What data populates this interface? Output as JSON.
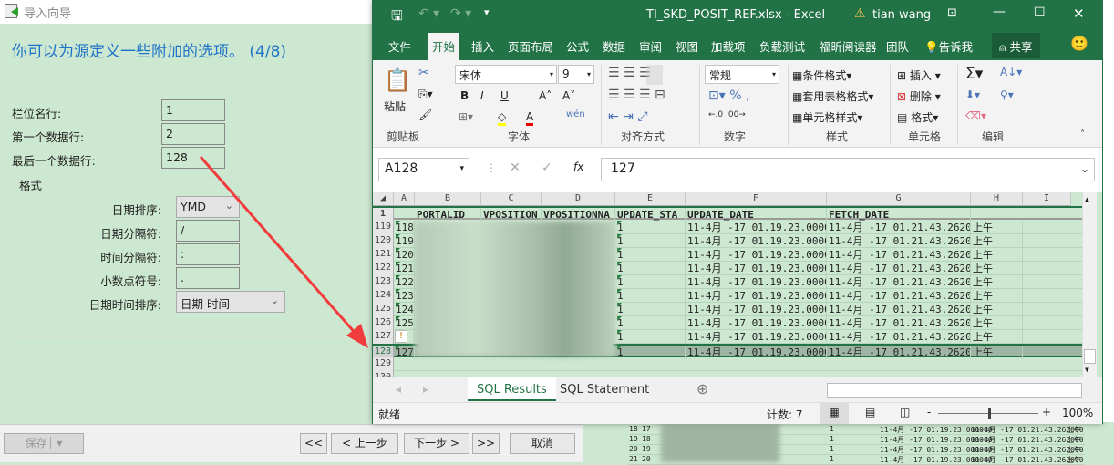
{
  "dialog": {
    "title": "导入向导",
    "heading": "你可以为源定义一些附加的选项。 (4/8)",
    "fields": [
      {
        "label": "栏位名行:",
        "value": "1"
      },
      {
        "label": "第一个数据行:",
        "value": "2"
      },
      {
        "label": "最后一个数据行:",
        "value": "128"
      }
    ],
    "format_label": "格式",
    "format_fields": [
      {
        "label": "日期排序:",
        "value": "YMD",
        "type": "select"
      },
      {
        "label": "日期分隔符:",
        "value": "/",
        "type": "input"
      },
      {
        "label": "时间分隔符:",
        "value": ":",
        "type": "input"
      },
      {
        "label": "小数点符号:",
        "value": ".",
        "type": "input"
      },
      {
        "label": "日期时间排序:",
        "value": "日期 时间",
        "type": "select"
      }
    ],
    "buttons": {
      "save": "保存",
      "first": "<<",
      "prev": "< 上一步",
      "next": "下一步 >",
      "last": ">>",
      "cancel": "取消"
    }
  },
  "excel": {
    "title": "TI_SKD_POSIT_REF.xlsx  -  Excel",
    "user": "tian wang",
    "tabs": [
      "文件",
      "开始",
      "插入",
      "页面布局",
      "公式",
      "数据",
      "审阅",
      "视图",
      "加载项",
      "负载测试",
      "福昕阅读器",
      "团队"
    ],
    "tell_me": "告诉我",
    "share": "共享",
    "ribbon": {
      "paste": "粘贴",
      "clipboard": "剪贴板",
      "font_name": "宋体",
      "font_size": "9",
      "font": "字体",
      "bold": "B",
      "italic": "I",
      "underline": "U",
      "alignment": "对齐方式",
      "number_format": "常规",
      "number": "数字",
      "cond_format": "条件格式",
      "table_format": "套用表格格式",
      "cell_style": "单元格样式",
      "styles": "样式",
      "insert": "插入",
      "delete": "删除",
      "format": "格式",
      "cells": "单元格",
      "editing": "编辑"
    },
    "name_box": "A128",
    "formula": "127",
    "columns": [
      "A",
      "B",
      "C",
      "D",
      "E",
      "F",
      "G",
      "H",
      "I"
    ],
    "header_row": {
      "num": "1",
      "b": "PORTALID",
      "c": "VPOSITION",
      "d": "VPOSITIONNA",
      "e": "UPDATE_STA",
      "f": "UPDATE_DATE",
      "g": "FETCH_DATE"
    },
    "rows": [
      {
        "num": "119",
        "a": "118",
        "e": "1",
        "f": "11-4月 -17 01.19.23.000000",
        "g": "11-4月 -17 01.21.43.262000",
        "h": "上午"
      },
      {
        "num": "120",
        "a": "119",
        "e": "1",
        "f": "11-4月 -17 01.19.23.000000",
        "g": "11-4月 -17 01.21.43.262000",
        "h": "上午"
      },
      {
        "num": "121",
        "a": "120",
        "e": "1",
        "f": "11-4月 -17 01.19.23.000000",
        "g": "11-4月 -17 01.21.43.262000",
        "h": "上午"
      },
      {
        "num": "122",
        "a": "121",
        "e": "1",
        "f": "11-4月 -17 01.19.23.000000",
        "g": "11-4月 -17 01.21.43.262000",
        "h": "上午"
      },
      {
        "num": "123",
        "a": "122",
        "e": "1",
        "f": "11-4月 -17 01.19.23.000000",
        "g": "11-4月 -17 01.21.43.262000",
        "h": "上午"
      },
      {
        "num": "124",
        "a": "123",
        "e": "1",
        "f": "11-4月 -17 01.19.23.000000",
        "g": "11-4月 -17 01.21.43.262000",
        "h": "上午"
      },
      {
        "num": "125",
        "a": "124",
        "e": "1",
        "f": "11-4月 -17 01.19.23.000000",
        "g": "11-4月 -17 01.21.43.262000",
        "h": "上午"
      },
      {
        "num": "126",
        "a": "125",
        "e": "1",
        "f": "11-4月 -17 01.19.23.000000",
        "g": "11-4月 -17 01.21.43.262000",
        "h": "上午"
      },
      {
        "num": "127",
        "a": "",
        "e": "1",
        "f": "11-4月 -17 01.19.23.000000",
        "g": "11-4月 -17 01.21.43.262000",
        "h": "上午"
      },
      {
        "num": "128",
        "a": "127",
        "e": "1",
        "f": "11-4月 -17 01.19.23.000000",
        "g": "11-4月 -17 01.21.43.262000",
        "h": "上午"
      },
      {
        "num": "129",
        "a": "",
        "e": "",
        "f": "",
        "g": "",
        "h": ""
      },
      {
        "num": "130",
        "a": "",
        "e": "",
        "f": "",
        "g": "",
        "h": ""
      }
    ],
    "sheet_tabs": [
      "SQL Results",
      "SQL Statement"
    ],
    "status": {
      "ready": "就绪",
      "count": "计数: 7",
      "zoom": "100%",
      "zoom_percent": 100
    }
  },
  "background_rows": [
    {
      "num": "18",
      "a": "17",
      "e": "1",
      "f": "11-4月 -17 01.19.23.000000",
      "g": "11-4月 -17 01.21.43.262000",
      "h": "上午"
    },
    {
      "num": "19",
      "a": "18",
      "e": "1",
      "f": "11-4月 -17 01.19.23.000000",
      "g": "11-4月 -17 01.21.43.262000",
      "h": "上午"
    },
    {
      "num": "20",
      "a": "19",
      "e": "1",
      "f": "11-4月 -17 01.19.23.000000",
      "g": "11-4月 -17 01.21.43.262000",
      "h": "上午"
    },
    {
      "num": "21",
      "a": "20",
      "e": "1",
      "f": "11-4月 -17 01.19.23.000000",
      "g": "11-4月 -17 01.21.43.262000",
      "h": "上午"
    }
  ],
  "colors": {
    "excel_green": "#217346",
    "sheet_bg": "#cde8d0",
    "heading_blue": "#1e73c8",
    "arrow_red": "#f03c3c"
  }
}
